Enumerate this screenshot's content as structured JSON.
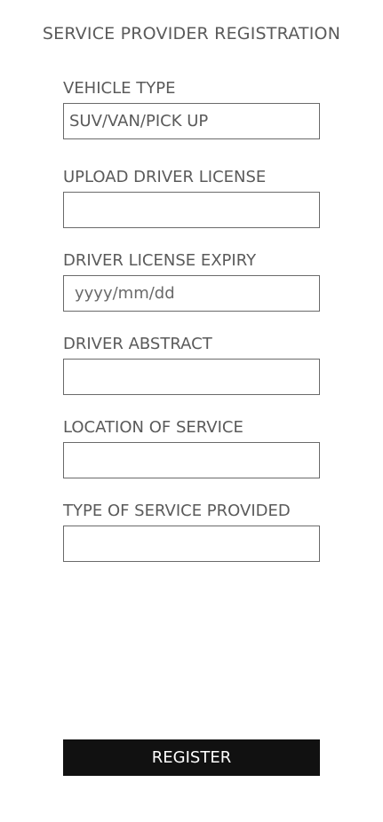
{
  "header": {
    "title": "SERVICE PROVIDER REGISTRATION"
  },
  "form": {
    "vehicle_type": {
      "label": "VEHICLE TYPE",
      "value": "SUV/VAN/PICK UP"
    },
    "driver_license_upload": {
      "label": "UPLOAD DRIVER LICENSE",
      "value": ""
    },
    "driver_license_expiry": {
      "label": "DRIVER LICENSE EXPIRY",
      "placeholder": "yyyy/mm/dd"
    },
    "driver_abstract": {
      "label": "DRIVER ABSTRACT",
      "value": ""
    },
    "location_of_service": {
      "label": "LOCATION OF SERVICE",
      "value": ""
    },
    "type_of_service": {
      "label": "TYPE OF SERVICE PROVIDED",
      "value": ""
    },
    "register_label": "REGISTER"
  },
  "colors": {
    "text": "#5a5a5a",
    "border": "#6a6a6a",
    "button_bg": "#111111",
    "button_text": "#ffffff"
  }
}
